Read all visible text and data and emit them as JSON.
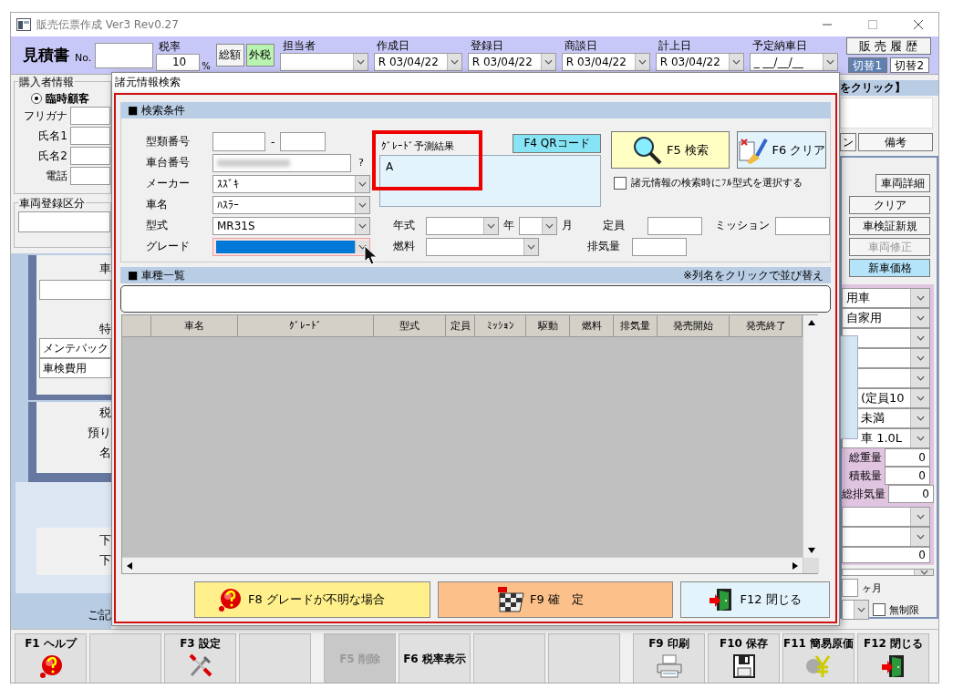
{
  "window": {
    "title": "販売伝票作成 Ver3 Rev0.27"
  },
  "header": {
    "doc_title": "見積書",
    "no_label": "No.",
    "tax_label": "税率",
    "tax_rate": "10",
    "tax_unit": "%",
    "tax_modes": [
      {
        "label": "総額",
        "selected": false
      },
      {
        "label": "外税",
        "selected": true
      }
    ],
    "staff_label": "担当者",
    "dates": [
      {
        "label": "作成日",
        "value": "R 03/04/22"
      },
      {
        "label": "登録日",
        "value": "R 03/04/22"
      },
      {
        "label": "商談日",
        "value": "R 03/04/22"
      },
      {
        "label": "計上日",
        "value": "R 03/04/22"
      },
      {
        "label": "予定納車日",
        "value": "_ __/__/__"
      }
    ],
    "history_button": "販 売 履 歴",
    "switch_tabs": [
      {
        "label": "切替1",
        "selected": true
      },
      {
        "label": "切替2",
        "selected": false
      }
    ]
  },
  "left_panel": {
    "buyer_group": "購入者情報",
    "customer_radio": {
      "label": "臨時顧客",
      "selected": true
    },
    "buyer_fields": [
      "フリガナ",
      "氏名1",
      "氏名2",
      "電話"
    ],
    "registration_group": "車両登録区分",
    "vehicle_label": "車",
    "special_label": "特",
    "special_items": [
      "メンテパック",
      "車検費用"
    ],
    "amount_labels": [
      "税",
      "預り",
      "名"
    ],
    "lower_labels": [
      "下",
      "下"
    ],
    "note_label": "ご記"
  },
  "right_panel": {
    "banner": "をクリック】",
    "tabs": [
      "ン",
      "備考"
    ],
    "buttons": [
      {
        "label": "車両詳細",
        "disabled": false,
        "highlighted": false
      },
      {
        "label": "クリア",
        "disabled": false,
        "highlighted": false
      },
      {
        "label": "車検証新規",
        "disabled": false,
        "highlighted": false
      },
      {
        "label": "車両修正",
        "disabled": true,
        "highlighted": false
      },
      {
        "label": "新車価格",
        "disabled": false,
        "highlighted": true
      }
    ],
    "selects_top": [
      {
        "value": "用車"
      },
      {
        "value": "自家用"
      }
    ],
    "selects_mid": [
      {
        "value": "(定員10"
      },
      {
        "value": "未満"
      },
      {
        "value": "車 1.0L"
      }
    ],
    "weights": [
      {
        "label": "総重量",
        "value": "0"
      },
      {
        "label": "積載量",
        "value": "0"
      },
      {
        "label": "総排気量",
        "value": "0"
      }
    ],
    "extra_value": "0",
    "months_label": "ヶ月",
    "unlimited": {
      "label": "無制限",
      "checked": false
    }
  },
  "dialog": {
    "title": "諸元情報検索",
    "conditions": {
      "heading": "■ 検索条件",
      "model_number_label": "型類番号",
      "model_number_sep": "-",
      "chassis": {
        "label": "車台番号",
        "help": "?"
      },
      "selects": [
        {
          "label": "メーカー",
          "value": "ｽｽﾞｷ",
          "focused": false
        },
        {
          "label": "車名",
          "value": "ﾊｽﾗｰ",
          "focused": false
        },
        {
          "label": "型式",
          "value": "MR31S",
          "focused": false
        },
        {
          "label": "グレード",
          "focused": true
        }
      ],
      "prediction": {
        "label": "ｸﾞﾚｰﾄﾞ予測結果",
        "value": "A",
        "highlighted": true
      },
      "qr_button": "F4 QRコード",
      "search_button": "F5 検索",
      "clear_button": "F6 クリア",
      "full_model_option": {
        "label": "諸元情報の検索時にﾌﾙ型式を選択する",
        "checked": false
      },
      "year_label": "年式",
      "year_unit": "年",
      "month_unit": "月",
      "fuel_label": "燃料",
      "capacity_label": "定員",
      "mission_label": "ミッション",
      "displacement_label": "排気量"
    },
    "list": {
      "heading": "■ 車種一覧",
      "hint": "※列名をクリックで並び替え",
      "columns": [
        "車名",
        "ｸﾞﾚｰﾄﾞ",
        "型式",
        "定員",
        "ﾐｯｼｮﾝ",
        "駆動",
        "燃料",
        "排気量",
        "発売開始",
        "発売終了"
      ]
    },
    "buttons": [
      {
        "label": "F8 グレードが不明な場合",
        "kind": "help"
      },
      {
        "label": "F9 確　定",
        "kind": "confirm"
      },
      {
        "label": "F12 閉じる",
        "kind": "close"
      }
    ]
  },
  "function_keys": [
    {
      "kind": "help",
      "label": "F1 ヘルプ",
      "disabled": false
    },
    {
      "kind": "blank"
    },
    {
      "kind": "settings",
      "label": "F3 設定",
      "disabled": false
    },
    {
      "kind": "blank"
    },
    {
      "kind": "text",
      "label": "F5 削除",
      "disabled": true
    },
    {
      "kind": "text",
      "label": "F6 税率表示",
      "disabled": false
    },
    {
      "kind": "blank"
    },
    {
      "kind": "blank"
    },
    {
      "kind": "print",
      "label": "F9 印刷",
      "disabled": false
    },
    {
      "kind": "save",
      "label": "F10 保存",
      "disabled": false
    },
    {
      "kind": "cost",
      "label": "F11 簡易原価",
      "disabled": false
    },
    {
      "kind": "close",
      "label": "F12 閉じる",
      "disabled": false
    }
  ]
}
